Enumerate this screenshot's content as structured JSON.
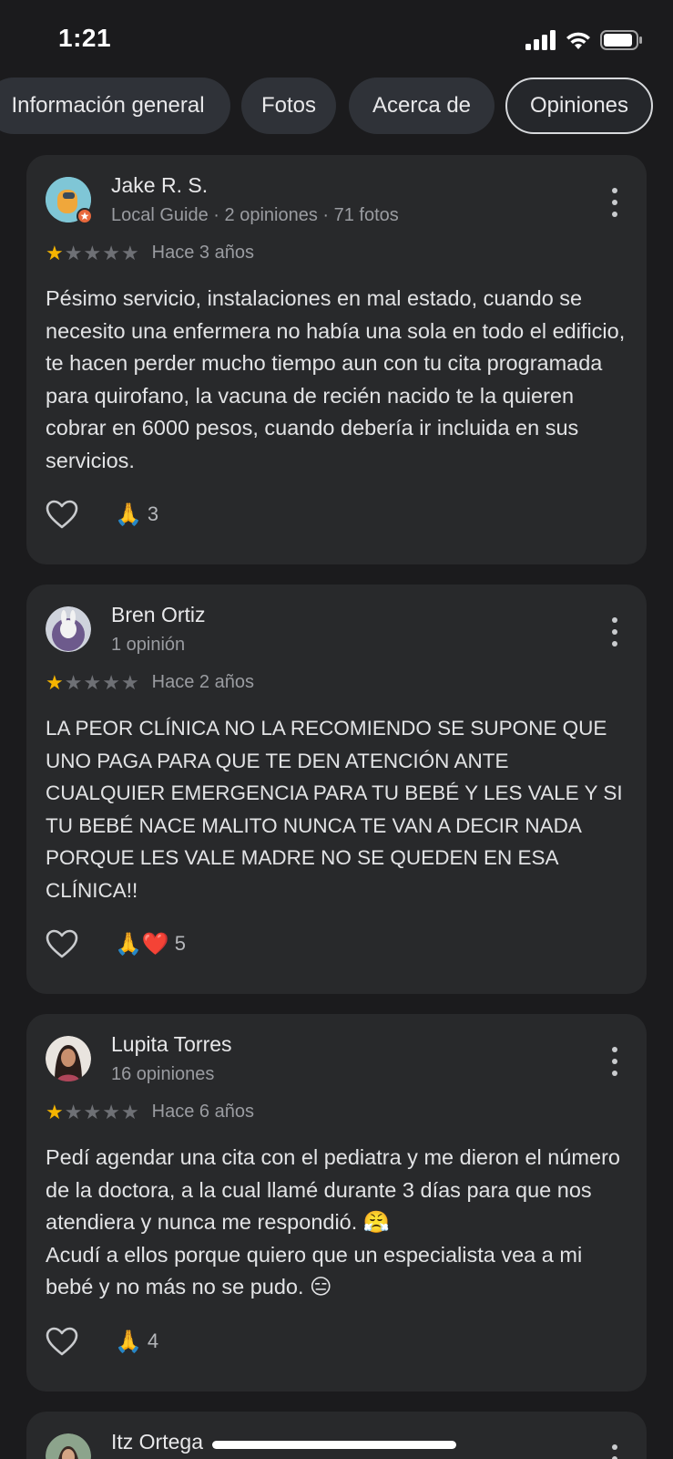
{
  "status": {
    "time": "1:21"
  },
  "tabs": [
    {
      "label": "Información general"
    },
    {
      "label": "Fotos"
    },
    {
      "label": "Acerca de"
    },
    {
      "label": "Opiniones"
    }
  ],
  "reviews": [
    {
      "name": "Jake R. S.",
      "meta": "Local Guide · 2 opiniones · 71 fotos",
      "rating": 1,
      "date": "Hace 3 años",
      "text": "Pésimo servicio, instalaciones en mal estado, cuando se necesito una enfermera no había una sola en todo el edificio, te hacen perder mucho tiempo aun con tu cita programada para quirofano, la vacuna de recién nacido te la quieren cobrar en 6000 pesos, cuando debería ir incluida en sus servicios.",
      "reactions": "🙏",
      "reaction_count": "3"
    },
    {
      "name": "Bren Ortiz",
      "meta": "1 opinión",
      "rating": 1,
      "date": "Hace 2 años",
      "text": "LA PEOR CLÍNICA NO LA RECOMIENDO SE SUPONE QUE UNO PAGA PARA QUE TE DEN ATENCIÓN ANTE CUALQUIER EMERGENCIA PARA TU BEBÉ Y LES VALE Y SI TU BEBÉ NACE MALITO NUNCA TE VAN A DECIR NADA PORQUE LES VALE MADRE NO SE QUEDEN EN ESA CLÍNICA!!",
      "reactions": "🙏❤️",
      "reaction_count": "5"
    },
    {
      "name": "Lupita Torres",
      "meta": "16 opiniones",
      "rating": 1,
      "date": "Hace 6 años",
      "text_line1": "Pedí agendar una cita con el pediatra y me dieron el número de la doctora, a la cual llamé durante 3 días para que nos atendiera y nunca me respondió. 😤",
      "text_line2": "Acudí a ellos porque quiero que un especialista vea a mi bebé y no más no se pudo. 😑",
      "reactions": "🙏",
      "reaction_count": "4"
    },
    {
      "name": "Itz Ortega"
    }
  ],
  "colors": {
    "background": "#1b1b1d",
    "card": "#28292b",
    "star_on": "#f5b400",
    "star_off": "#6e7075",
    "tab": "#2f3238"
  }
}
